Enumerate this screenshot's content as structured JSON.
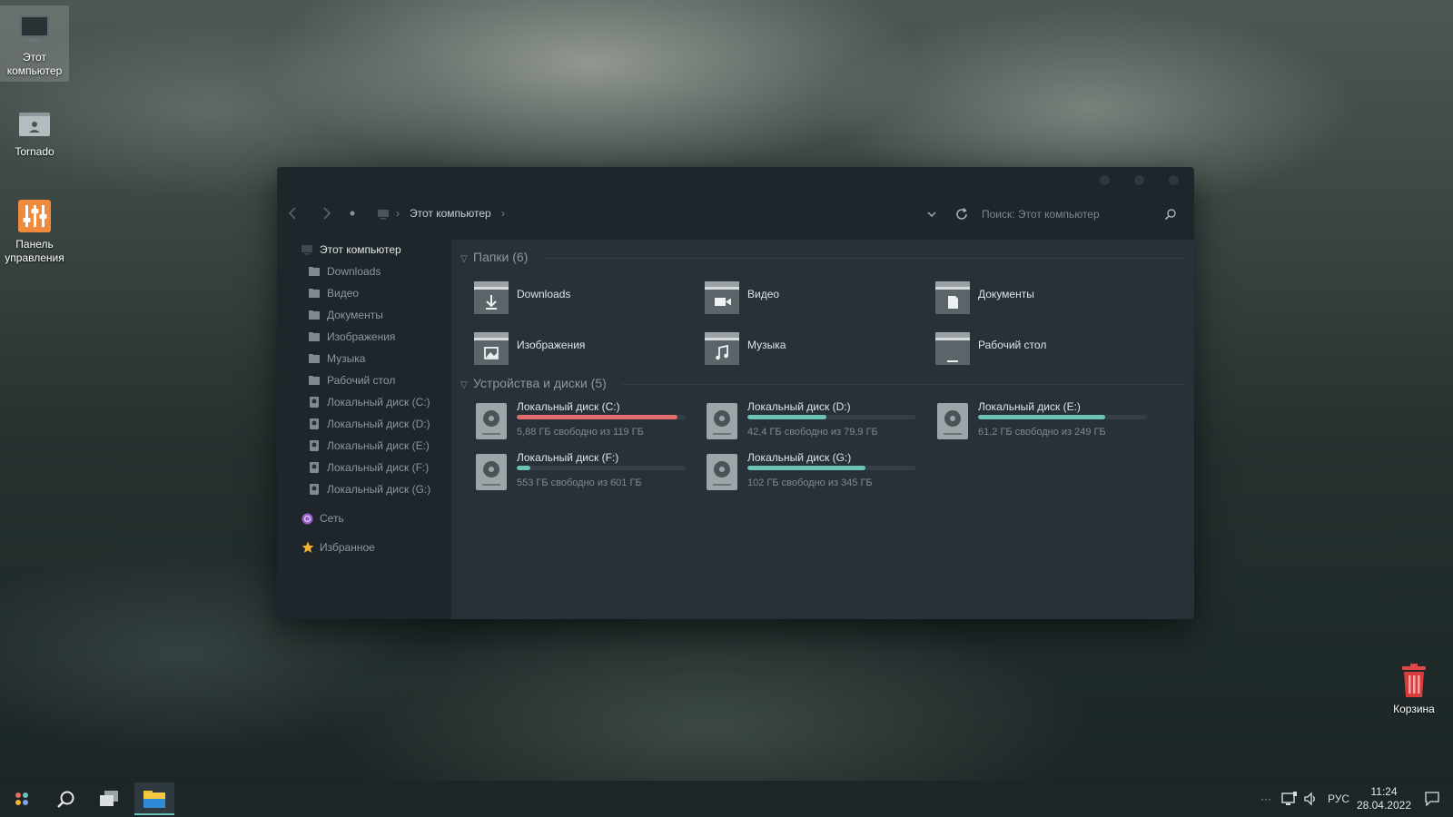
{
  "desktop": {
    "icons": [
      {
        "label": "Этот компьютер"
      },
      {
        "label": "Tornado"
      },
      {
        "label": "Панель управления"
      },
      {
        "label": "Корзина"
      }
    ]
  },
  "explorer": {
    "breadcrumb": "Этот компьютер",
    "search_placeholder": "Поиск: Этот компьютер",
    "sidebar": {
      "items": [
        {
          "label": "Этот компьютер"
        },
        {
          "label": "Downloads"
        },
        {
          "label": "Видео"
        },
        {
          "label": "Документы"
        },
        {
          "label": "Изображения"
        },
        {
          "label": "Музыка"
        },
        {
          "label": "Рабочий стол"
        },
        {
          "label": "Локальный диск (C:)"
        },
        {
          "label": "Локальный диск (D:)"
        },
        {
          "label": "Локальный диск (E:)"
        },
        {
          "label": "Локальный диск (F:)"
        },
        {
          "label": "Локальный диск (G:)"
        },
        {
          "label": "Сеть"
        },
        {
          "label": "Избранное"
        }
      ]
    },
    "folders_header": "Папки (6)",
    "folders": [
      {
        "name": "Downloads",
        "icon": "download-arrow-icon"
      },
      {
        "name": "Видео",
        "icon": "video-camera-icon"
      },
      {
        "name": "Документы",
        "icon": "document-icon"
      },
      {
        "name": "Изображения",
        "icon": "image-icon"
      },
      {
        "name": "Музыка",
        "icon": "music-note-icon"
      },
      {
        "name": "Рабочий стол",
        "icon": "desktop-icon"
      }
    ],
    "drives_header": "Устройства и диски (5)",
    "drives": [
      {
        "name": "Локальный диск (C:)",
        "free": "5,88 ГБ свободно из 119 ГБ",
        "used_fraction": 0.95,
        "color": "#e36d6d"
      },
      {
        "name": "Локальный диск (D:)",
        "free": "42,4 ГБ свободно из 79,9 ГБ",
        "used_fraction": 0.47,
        "color": "#6cc2b6"
      },
      {
        "name": "Локальный диск (E:)",
        "free": "61,2 ГБ свободно из 249 ГБ",
        "used_fraction": 0.75,
        "color": "#6cc2b6"
      },
      {
        "name": "Локальный диск (F:)",
        "free": "553 ГБ свободно из 601 ГБ",
        "used_fraction": 0.08,
        "color": "#6cc2b6"
      },
      {
        "name": "Локальный диск (G:)",
        "free": "102 ГБ свободно из 345 ГБ",
        "used_fraction": 0.7,
        "color": "#6cc2b6"
      }
    ]
  },
  "taskbar": {
    "language": "РУС",
    "time": "11:24",
    "date": "28.04.2022"
  }
}
